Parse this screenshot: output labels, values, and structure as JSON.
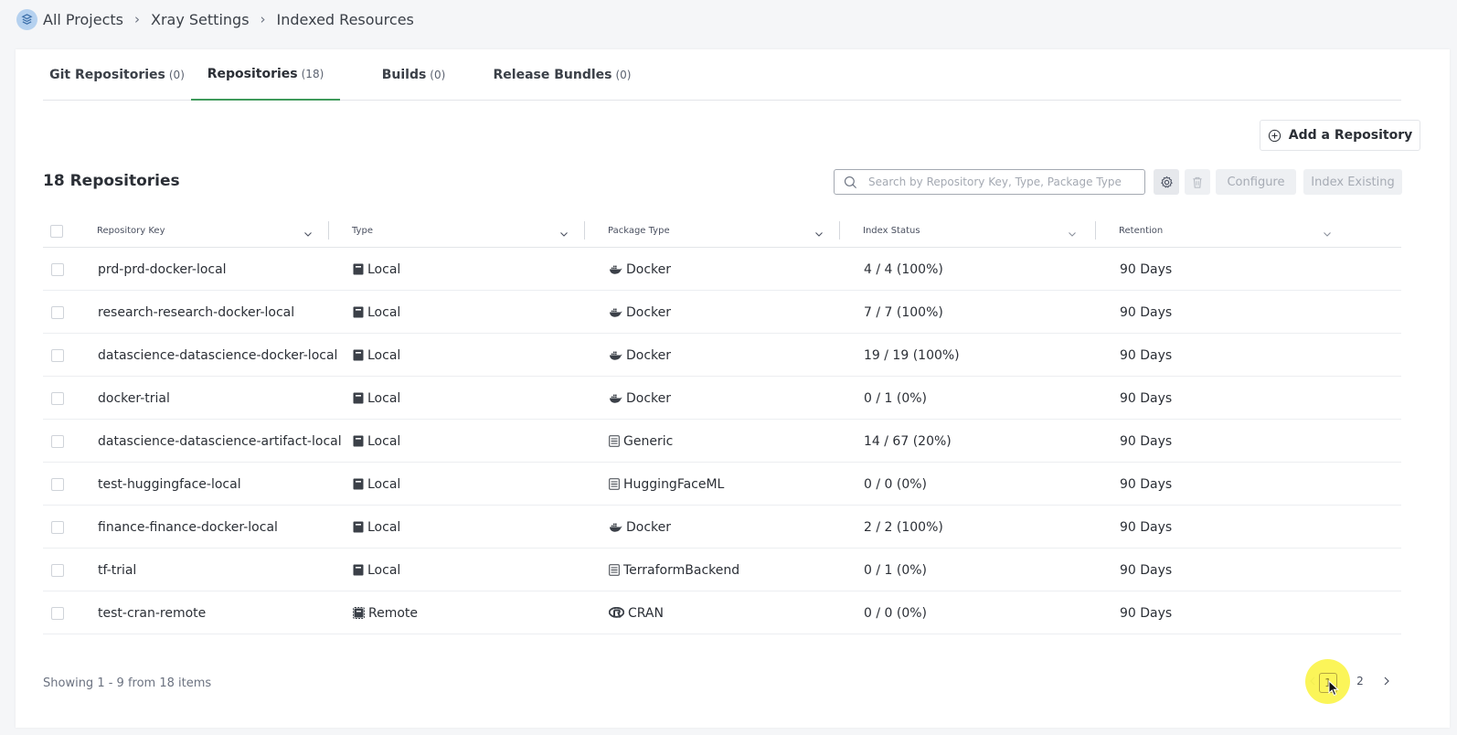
{
  "breadcrumb": {
    "items": [
      "All Projects",
      "Xray Settings",
      "Indexed Resources"
    ],
    "logo_icon": "jfrog-project-icon",
    "separator_icon": "chevron-right-icon"
  },
  "tabs": [
    {
      "label": "Git Repositories",
      "count": "(0)",
      "active": false
    },
    {
      "label": "Repositories",
      "count": "(18)",
      "active": true
    },
    {
      "label": "Builds",
      "count": "(0)",
      "active": false
    },
    {
      "label": "Release Bundles",
      "count": "(0)",
      "active": false
    }
  ],
  "toolbar": {
    "add_label": "Add a Repository",
    "count_title": "18 Repositories",
    "search_placeholder": "Search by Repository Key, Type, Package Type",
    "configure_label": "Configure",
    "index_label": "Index Existing"
  },
  "columns": [
    "Repository Key",
    "Type",
    "Package Type",
    "Index Status",
    "Retention"
  ],
  "rows": [
    {
      "key": "prd-prd-docker-local",
      "type": "Local",
      "type_icon": "local-repo-icon",
      "pkg": "Docker",
      "pkg_icon": "docker-icon",
      "status": "4 / 4 (100%)",
      "retention": "90 Days"
    },
    {
      "key": "research-research-docker-local",
      "type": "Local",
      "type_icon": "local-repo-icon",
      "pkg": "Docker",
      "pkg_icon": "docker-icon",
      "status": "7 / 7 (100%)",
      "retention": "90 Days"
    },
    {
      "key": "datascience-datascience-docker-local",
      "type": "Local",
      "type_icon": "local-repo-icon",
      "pkg": "Docker",
      "pkg_icon": "docker-icon",
      "status": "19 / 19 (100%)",
      "retention": "90 Days"
    },
    {
      "key": "docker-trial",
      "type": "Local",
      "type_icon": "local-repo-icon",
      "pkg": "Docker",
      "pkg_icon": "docker-icon",
      "status": "0 / 1 (0%)",
      "retention": "90 Days"
    },
    {
      "key": "datascience-datascience-artifact-local",
      "type": "Local",
      "type_icon": "local-repo-icon",
      "pkg": "Generic",
      "pkg_icon": "generic-icon",
      "status": "14 / 67 (20%)",
      "retention": "90 Days"
    },
    {
      "key": "test-huggingface-local",
      "type": "Local",
      "type_icon": "local-repo-icon",
      "pkg": "HuggingFaceML",
      "pkg_icon": "generic-icon",
      "status": "0 / 0 (0%)",
      "retention": "90 Days"
    },
    {
      "key": "finance-finance-docker-local",
      "type": "Local",
      "type_icon": "local-repo-icon",
      "pkg": "Docker",
      "pkg_icon": "docker-icon",
      "status": "2 / 2 (100%)",
      "retention": "90 Days"
    },
    {
      "key": "tf-trial",
      "type": "Local",
      "type_icon": "local-repo-icon",
      "pkg": "TerraformBackend",
      "pkg_icon": "generic-icon",
      "status": "0 / 1 (0%)",
      "retention": "90 Days"
    },
    {
      "key": "test-cran-remote",
      "type": "Remote",
      "type_icon": "remote-repo-icon",
      "pkg": "CRAN",
      "pkg_icon": "cran-icon",
      "status": "0 / 0 (0%)",
      "retention": "90 Days"
    }
  ],
  "footer": {
    "showing": "Showing 1 - 9 from 18 items",
    "pages": [
      "1",
      "2"
    ],
    "current_page": "1"
  },
  "colors": {
    "accent_green": "#3f9a5b",
    "highlight_yellow": "#faf33c",
    "text_dark": "#2b2f36"
  }
}
